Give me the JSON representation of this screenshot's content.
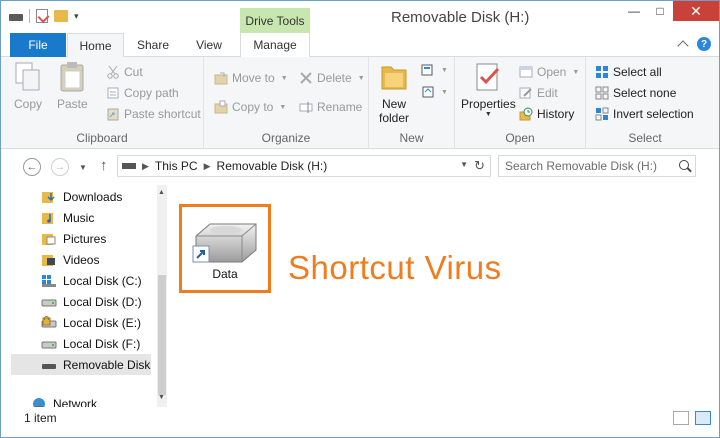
{
  "window": {
    "title": "Removable Disk (H:)",
    "context_tab_header": "Drive Tools",
    "minimize": "—",
    "maximize": "□",
    "close": "✕"
  },
  "tabs": {
    "file": "File",
    "home": "Home",
    "share": "Share",
    "view": "View",
    "manage": "Manage"
  },
  "ribbon": {
    "clipboard": {
      "label": "Clipboard",
      "copy": "Copy",
      "paste": "Paste",
      "cut": "Cut",
      "copy_path": "Copy path",
      "paste_shortcut": "Paste shortcut"
    },
    "organize": {
      "label": "Organize",
      "move_to": "Move to",
      "copy_to": "Copy to",
      "delete": "Delete",
      "rename": "Rename"
    },
    "new": {
      "label": "New",
      "new_folder_line1": "New",
      "new_folder_line2": "folder"
    },
    "open": {
      "label": "Open",
      "properties": "Properties",
      "open": "Open",
      "edit": "Edit",
      "history": "History"
    },
    "select": {
      "label": "Select",
      "select_all": "Select all",
      "select_none": "Select none",
      "invert_selection": "Invert selection"
    }
  },
  "address": {
    "crumbs": [
      "This PC",
      "Removable Disk (H:)"
    ],
    "search_placeholder": "Search Removable Disk (H:)"
  },
  "nav_pane": {
    "items": [
      {
        "label": "Downloads",
        "icon": "downloads-folder-icon"
      },
      {
        "label": "Music",
        "icon": "music-folder-icon"
      },
      {
        "label": "Pictures",
        "icon": "pictures-folder-icon"
      },
      {
        "label": "Videos",
        "icon": "videos-folder-icon"
      },
      {
        "label": "Local Disk (C:)",
        "icon": "system-drive-icon"
      },
      {
        "label": "Local Disk (D:)",
        "icon": "drive-icon"
      },
      {
        "label": "Local Disk (E:)",
        "icon": "locked-drive-icon"
      },
      {
        "label": "Local Disk (F:)",
        "icon": "drive-icon"
      },
      {
        "label": "Removable Disk",
        "icon": "removable-drive-icon"
      },
      {
        "label": "Network",
        "icon": "network-icon"
      }
    ]
  },
  "content": {
    "files": [
      {
        "name": "Data",
        "icon": "drive-shortcut-icon"
      }
    ],
    "annotation": "Shortcut Virus"
  },
  "status": {
    "item_count": "1 item"
  },
  "colors": {
    "accent": "#1979ca",
    "annotation": "#f07c1e",
    "drive_tools": "#c8e6b0",
    "close_button": "#c9423a"
  }
}
